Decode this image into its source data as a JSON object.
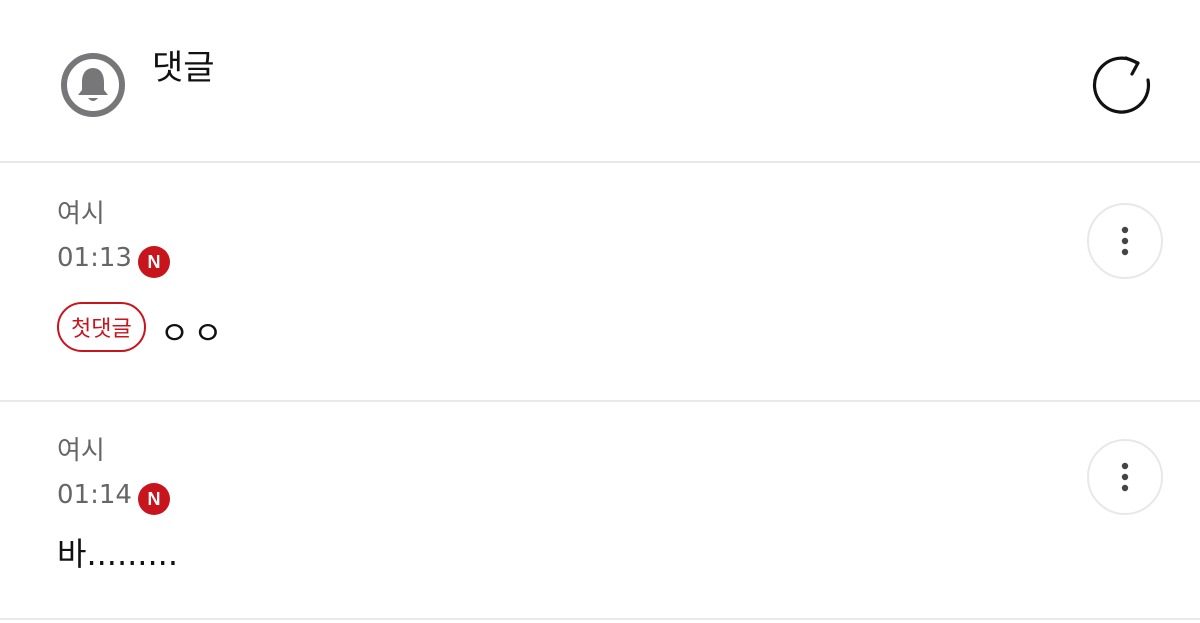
{
  "header": {
    "title": "댓글",
    "icons": {
      "left": "bell-icon",
      "right": "refresh-icon"
    }
  },
  "comments": [
    {
      "author": "여시",
      "time": "01:13",
      "new_badge": "N",
      "tag": "첫댓글",
      "text": "ㅇㅇ"
    },
    {
      "author": "여시",
      "time": "01:14",
      "new_badge": "N",
      "text": "바........."
    }
  ],
  "colors": {
    "accent": "#c8151d",
    "divider": "#e9e9e9",
    "icon_gray": "#77777a",
    "meta_text": "#666666",
    "primary_text": "#111111"
  }
}
